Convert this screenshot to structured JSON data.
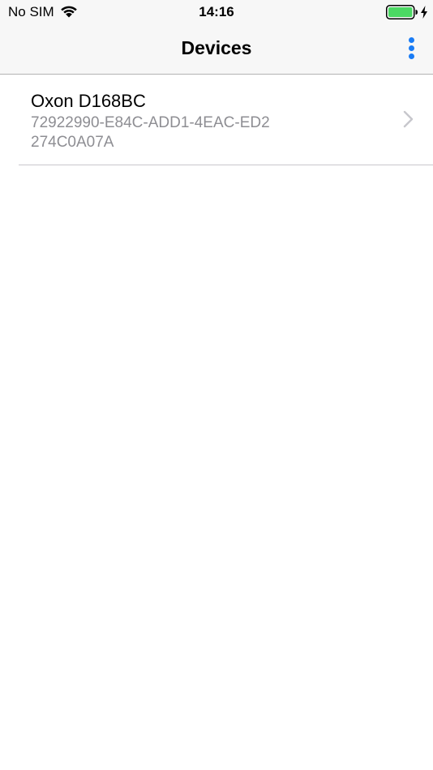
{
  "status_bar": {
    "carrier": "No SIM",
    "time": "14:16",
    "wifi_icon": "wifi-icon",
    "battery_icon": "battery-icon",
    "battery_color": "#4cd964"
  },
  "nav_bar": {
    "title": "Devices",
    "more_icon": "more-vertical-icon",
    "accent_color": "#1a7cf5"
  },
  "devices": [
    {
      "name": "Oxon D168BC",
      "identifier": "72922990-E84C-ADD1-4EAC-ED2274C0A07A",
      "chevron_icon": "chevron-right-icon"
    }
  ]
}
